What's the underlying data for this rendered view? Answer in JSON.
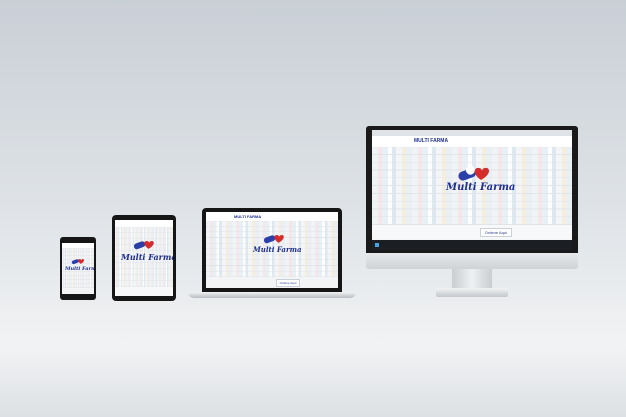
{
  "site": {
    "brand_name": "Multi Farma",
    "header_title": "MULTI FARMA",
    "cta_label": "Ordene Aquí"
  },
  "colors": {
    "brand_blue": "#1f2f8f",
    "capsule_red": "#d62b2b",
    "capsule_blue": "#2a3fa8"
  },
  "icons": [
    "capsule-logo-icon",
    "heart-icon",
    "browser-tab-icon",
    "windows-start-icon"
  ]
}
